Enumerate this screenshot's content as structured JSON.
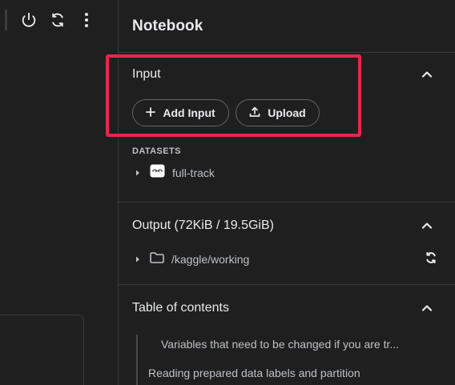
{
  "panel": {
    "title": "Notebook",
    "input": {
      "heading": "Input",
      "add_input_label": "Add Input",
      "upload_label": "Upload",
      "datasets_label": "DATASETS",
      "datasets": [
        {
          "name": "full-track"
        }
      ]
    },
    "output": {
      "heading": "Output (72KiB / 19.5GiB)",
      "items": [
        {
          "path": "/kaggle/working"
        }
      ]
    },
    "toc": {
      "heading": "Table of contents",
      "items": [
        {
          "label": "Variables that need to be changed if you are tr..."
        },
        {
          "label": "Reading prepared data labels and partition"
        }
      ]
    }
  },
  "colors": {
    "background": "#1f1f1f",
    "border": "#3a3a3a",
    "text": "#e8eaed",
    "muted_text": "#bdc1c6",
    "highlight": "#e8254f"
  },
  "icons": {
    "toolbar": [
      "power-icon",
      "refresh-icon",
      "more-vert-icon"
    ],
    "input_collapse": "chevron-up-icon",
    "add": "plus-icon",
    "upload": "upload-icon",
    "dataset": "dataset-icon",
    "folder": "folder-icon"
  }
}
